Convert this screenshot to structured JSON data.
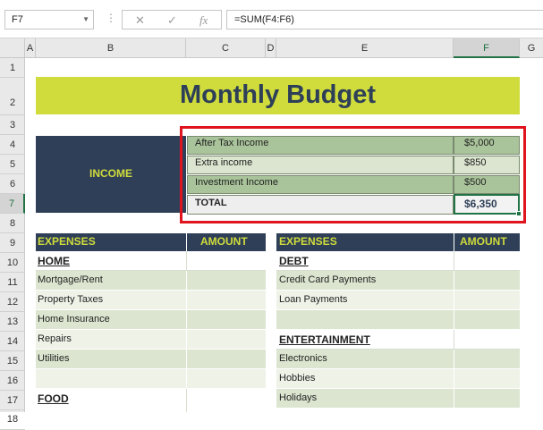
{
  "formula_bar": {
    "name_box": "F7",
    "cancel_icon": "✕",
    "enter_icon": "✓",
    "fx_icon": "fx",
    "formula": "=SUM(F4:F6)"
  },
  "columns": [
    "A",
    "B",
    "C",
    "D",
    "E",
    "F",
    "G"
  ],
  "rows": [
    "1",
    "2",
    "3",
    "4",
    "5",
    "6",
    "7",
    "8",
    "9",
    "10",
    "11",
    "12",
    "13",
    "14",
    "15",
    "16",
    "17",
    "18"
  ],
  "title": "Monthly Budget",
  "income": {
    "label": "INCOME",
    "items": [
      {
        "name": "After Tax Income",
        "amount": "$5,000"
      },
      {
        "name": "Extra income",
        "amount": "$850"
      },
      {
        "name": "Investment Income",
        "amount": "$500"
      }
    ],
    "total_label": "TOTAL",
    "total_value": "$6,350"
  },
  "expenses_left": {
    "header": "EXPENSES",
    "amount_header": "AMOUNT",
    "rows": [
      "HOME",
      "Mortgage/Rent",
      "Property Taxes",
      "Home Insurance",
      "Repairs",
      "Utilities",
      "",
      "FOOD"
    ]
  },
  "expenses_right": {
    "header": "EXPENSES",
    "amount_header": "AMOUNT",
    "rows": [
      "DEBT",
      "Credit Card Payments",
      "Loan Payments",
      "",
      "ENTERTAINMENT",
      "Electronics",
      "Hobbies",
      "Holidays"
    ]
  },
  "colors": {
    "navy": "#2f3f57",
    "lime": "#cfdc3c",
    "green_dark": "#a9c49a",
    "green_light": "#dbe5cf",
    "highlight_red": "#e0141e",
    "excel_green": "#217346"
  }
}
